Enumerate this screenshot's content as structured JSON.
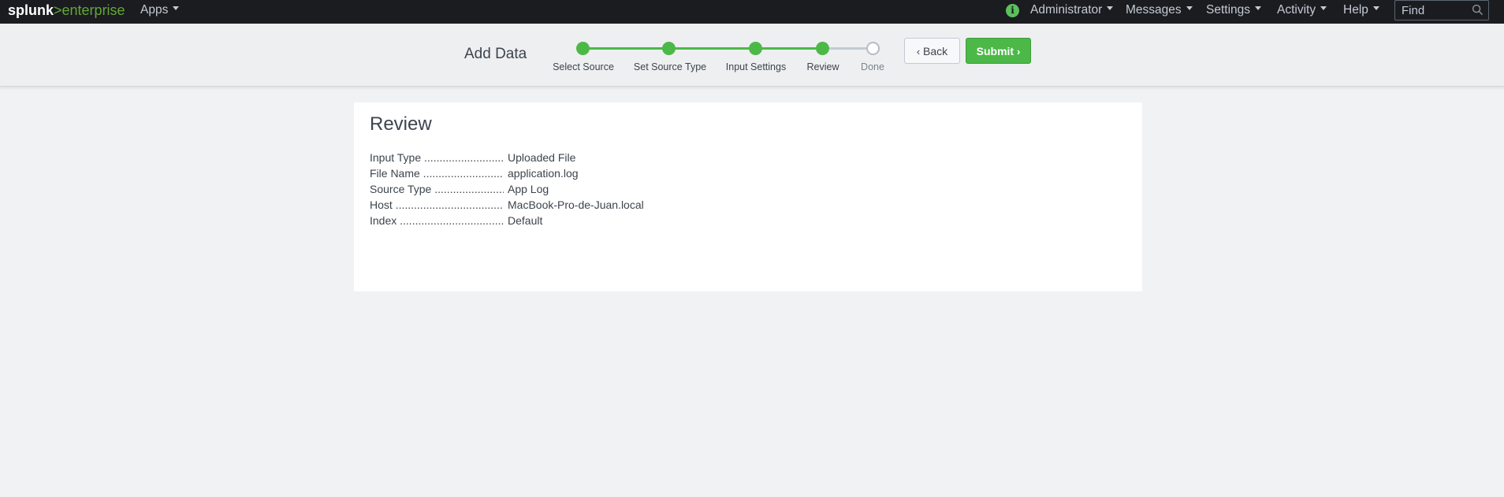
{
  "nav": {
    "logo_part1": "splunk",
    "logo_part2": ">enterprise",
    "apps": "Apps",
    "info_glyph": "i",
    "administrator": "Administrator",
    "messages": "Messages",
    "settings": "Settings",
    "activity": "Activity",
    "help": "Help",
    "find_placeholder": "Find"
  },
  "header": {
    "title": "Add Data",
    "steps": [
      {
        "label": "Select Source",
        "status": "complete"
      },
      {
        "label": "Set Source Type",
        "status": "complete"
      },
      {
        "label": "Input Settings",
        "status": "complete"
      },
      {
        "label": "Review",
        "status": "current"
      },
      {
        "label": "Done",
        "status": "pending"
      }
    ],
    "back_label": "Back",
    "submit_label": "Submit"
  },
  "review": {
    "title": "Review",
    "rows": [
      {
        "label": "Input Type",
        "value": "Uploaded File"
      },
      {
        "label": "File Name",
        "value": "application.log"
      },
      {
        "label": "Source Type",
        "value": "App Log"
      },
      {
        "label": "Host",
        "value": "MacBook-Pro-de-Juan.local"
      },
      {
        "label": "Index",
        "value": "Default"
      }
    ]
  },
  "colors": {
    "accent_green": "#4cb848",
    "nav_bg": "#1a1c20",
    "page_bg": "#f1f2f3"
  },
  "icons": [
    "info-icon",
    "caret-down-icon",
    "search-icon",
    "chevron-left-icon",
    "chevron-right-icon"
  ]
}
